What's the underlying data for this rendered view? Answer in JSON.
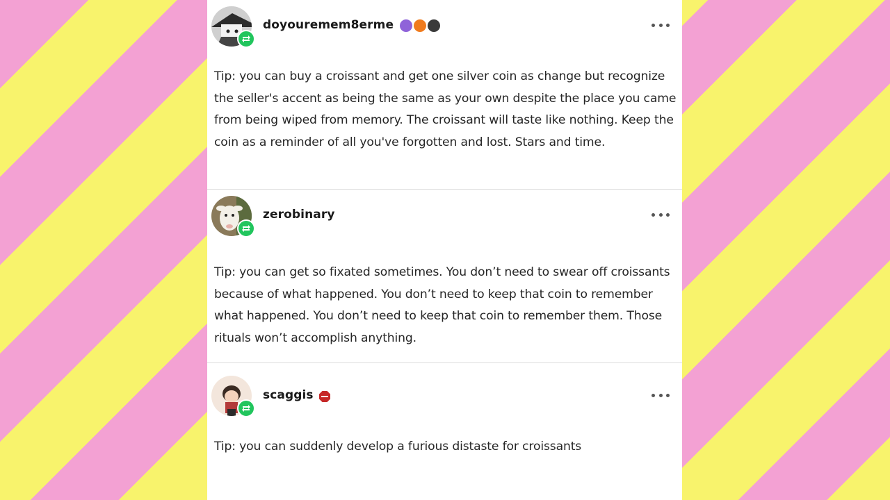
{
  "posts": [
    {
      "username": "doyouremem8erme",
      "text": "Tip: you can buy a croissant and get one silver coin as change but recognize the seller's accent as being the same as your own despite the place you came from being wiped from memory. The croissant will taste like nothing. Keep the coin as a reminder of all you've forgotten and lost. Stars and time.",
      "badges": [
        "badge-purple-icon",
        "badge-orange-paw-icon",
        "badge-dark-bell-icon"
      ]
    },
    {
      "username": "zerobinary",
      "text": "Tip: you can get so fixated sometimes. You don’t need to swear off croissants because of what happened. You don’t need to keep that coin to remember what happened. You don’t need to keep that coin to remember them. Those rituals won’t accomplish anything.",
      "badges": []
    },
    {
      "username": "scaggis",
      "text": "Tip: you can suddenly develop a furious distaste for croissants",
      "badges": [
        "badge-red-octagon-icon"
      ]
    }
  ],
  "colors": {
    "stripe_pink": "#f3a1d3",
    "stripe_yellow": "#f8f36c",
    "reblog_green": "#21c55d",
    "text": "#262626"
  }
}
